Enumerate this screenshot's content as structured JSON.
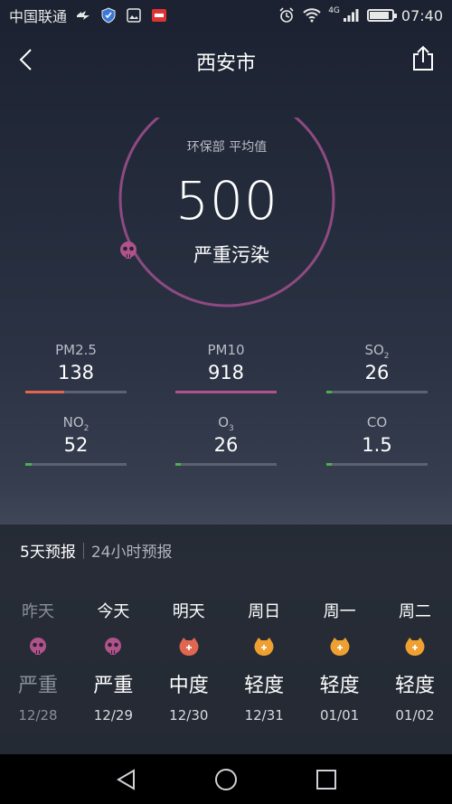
{
  "status_bar": {
    "carrier": "中国联通",
    "network": "4G",
    "time": "07:40",
    "battery_level": 0.9
  },
  "header": {
    "title": "西安市"
  },
  "aqi": {
    "source_label": "环保部 平均值",
    "value": "500",
    "level": "严重污染",
    "ring_color": "#8e4a82"
  },
  "pollutants": [
    {
      "name": "PM2.5",
      "sub": "",
      "value": "138",
      "level": 0.38,
      "color": "#e0664f"
    },
    {
      "name": "PM10",
      "sub": "",
      "value": "918",
      "level": 1.0,
      "color": "#b0528c"
    },
    {
      "name": "SO",
      "sub": "2",
      "value": "26",
      "level": 0.03,
      "color": "#4caf50"
    },
    {
      "name": "NO",
      "sub": "2",
      "value": "52",
      "level": 0.06,
      "color": "#4caf50"
    },
    {
      "name": "O",
      "sub": "3",
      "value": "26",
      "level": 0.03,
      "color": "#4caf50"
    },
    {
      "name": "CO",
      "sub": "",
      "value": "1.5",
      "level": 0.03,
      "color": "#4caf50"
    }
  ],
  "forecast": {
    "tabs": [
      "5天预报",
      "24小时预报"
    ],
    "days": [
      {
        "name": "昨天",
        "level": "严重",
        "date": "12/28",
        "icon": "skull-icon",
        "color": "#b0528c",
        "past": true
      },
      {
        "name": "今天",
        "level": "严重",
        "date": "12/29",
        "icon": "skull-icon",
        "color": "#b0528c",
        "past": false
      },
      {
        "name": "明天",
        "level": "中度",
        "date": "12/30",
        "icon": "face-icon",
        "color": "#e0664f",
        "past": false
      },
      {
        "name": "周日",
        "level": "轻度",
        "date": "12/31",
        "icon": "face-icon",
        "color": "#f0a030",
        "past": false
      },
      {
        "name": "周一",
        "level": "轻度",
        "date": "01/01",
        "icon": "face-icon",
        "color": "#f0a030",
        "past": false
      },
      {
        "name": "周二",
        "level": "轻度",
        "date": "01/02",
        "icon": "face-icon",
        "color": "#f0a030",
        "past": false
      }
    ]
  }
}
